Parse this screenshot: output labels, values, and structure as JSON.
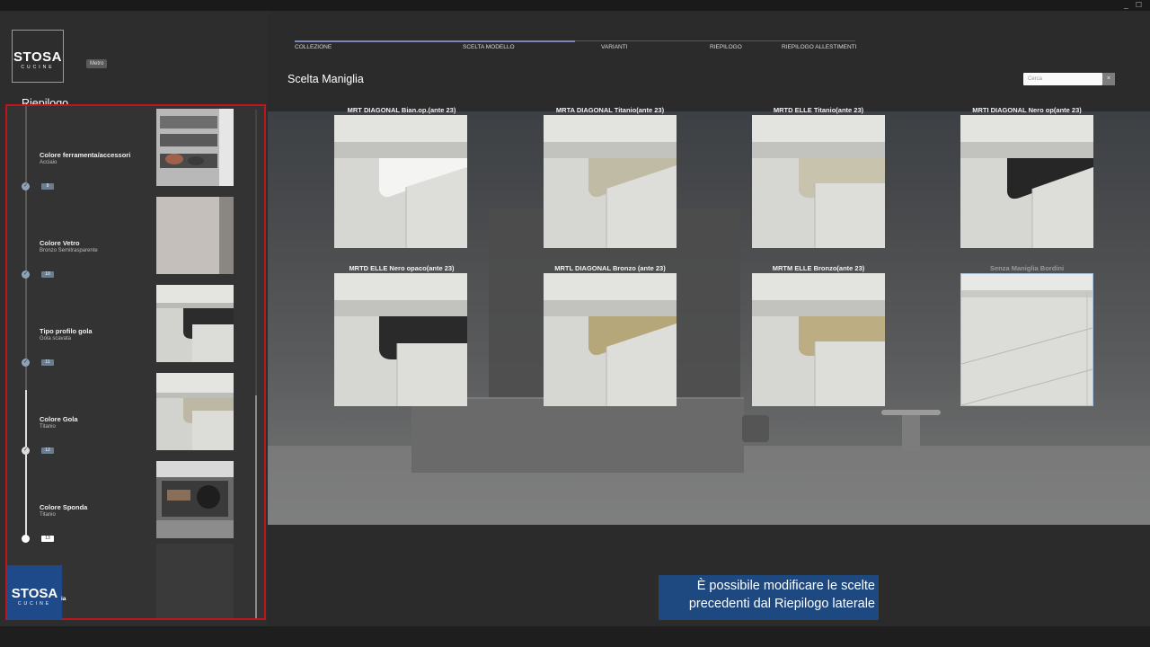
{
  "window": {
    "controls": "_ ☐"
  },
  "brand": {
    "logo_main": "STOSA",
    "logo_sub": "CUCINE",
    "badge": "Metro",
    "corner_suffix": "ia"
  },
  "sidebar": {
    "title": "Riepilogo",
    "items": [
      {
        "label": "Colore ferramenta/accessori",
        "value": "Acciaio",
        "step": "9"
      },
      {
        "label": "Colore Vetro",
        "value": "Bronzo Semitrasparente",
        "step": "10"
      },
      {
        "label": "Tipo profilo gola",
        "value": "Gola scavata",
        "step": "11"
      },
      {
        "label": "Colore Gola",
        "value": "Titanio",
        "step": "12"
      },
      {
        "label": "Colore Sponda",
        "value": "Titanio",
        "step": "13"
      }
    ]
  },
  "nav": {
    "steps": [
      "COLLEZIONE",
      "SCELTA MODELLO",
      "VARIANTI",
      "RIEPILOGO",
      "RIEPILOGO ALLESTIMENTI"
    ],
    "progress": 0.5
  },
  "main": {
    "title": "Scelta Maniglia",
    "search_placeholder": "Cerca",
    "search_clear": "×",
    "options": [
      {
        "name": "MRT DIAGONAL Bian.op.(ante 23)",
        "profile": "white-lit"
      },
      {
        "name": "MRTA DIAGONAL Titanio(ante 23)",
        "profile": "titanium"
      },
      {
        "name": "MRTD ELLE Titanio(ante 23)",
        "profile": "titanium-elle"
      },
      {
        "name": "MRTI DIAGONAL Nero op(ante 23)",
        "profile": "black"
      },
      {
        "name": "MRTD ELLE Nero opaco(ante 23)",
        "profile": "black-elle"
      },
      {
        "name": "MRTL DIAGONAL Bronzo (ante 23)",
        "profile": "bronze"
      },
      {
        "name": "MRTM ELLE Bronzo(ante 23)",
        "profile": "bronze-elle"
      },
      {
        "name": "Senza Maniglia Bordini",
        "profile": "none"
      }
    ]
  },
  "hint": {
    "line1": "È possibile modificare le scelte",
    "line2": "precedenti dal Riepilogo laterale"
  },
  "colors": {
    "accent_red": "#c0151b",
    "brand_blue": "#1f4a8a",
    "progress": "#7e86b8"
  }
}
